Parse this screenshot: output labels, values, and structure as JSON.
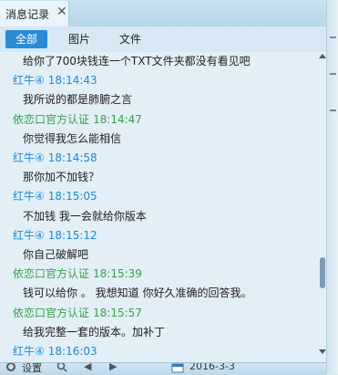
{
  "tab": {
    "label": "消息记录",
    "close": "✕"
  },
  "filters": [
    {
      "label": "全部",
      "active": true
    },
    {
      "label": "图片",
      "active": false
    },
    {
      "label": "文件",
      "active": false
    }
  ],
  "messages": [
    {
      "type": "text",
      "text": "给你了700块钱连一个TXT文件夹都没有看见吧"
    },
    {
      "type": "header",
      "role": "self",
      "sender": "红牛④",
      "time": "18:14:43"
    },
    {
      "type": "text",
      "text": "我所说的都是肺腑之言"
    },
    {
      "type": "header",
      "role": "other",
      "sender": "依恋口官方认证",
      "time": "18:14:47"
    },
    {
      "type": "text",
      "text": "你觉得我怎么能相信"
    },
    {
      "type": "header",
      "role": "self",
      "sender": "红牛④",
      "time": "18:14:58"
    },
    {
      "type": "text",
      "text": "那你加不加钱？"
    },
    {
      "type": "header",
      "role": "self",
      "sender": "红牛④",
      "time": "18:15:05"
    },
    {
      "type": "text",
      "text": "不加钱 我一会就给你版本"
    },
    {
      "type": "header",
      "role": "self",
      "sender": "红牛④",
      "time": "18:15:12"
    },
    {
      "type": "text",
      "text": "你自己破解吧"
    },
    {
      "type": "header",
      "role": "other",
      "sender": "依恋口官方认证",
      "time": "18:15:39"
    },
    {
      "type": "text",
      "text": "钱可以给你 。 我想知道 你好久准确的回答我。"
    },
    {
      "type": "header",
      "role": "other",
      "sender": "依恋口官方认证",
      "time": "18:15:57"
    },
    {
      "type": "text",
      "text": "给我完整一套的版本。加补丁"
    },
    {
      "type": "header",
      "role": "self",
      "sender": "红牛④",
      "time": "18:16:03"
    }
  ],
  "bottom": {
    "settings": "设置",
    "date": "2016-3-3"
  },
  "colors": {
    "self": "#1a8ad0",
    "other": "#35a04a",
    "active_filter": "#2d8bd6"
  }
}
